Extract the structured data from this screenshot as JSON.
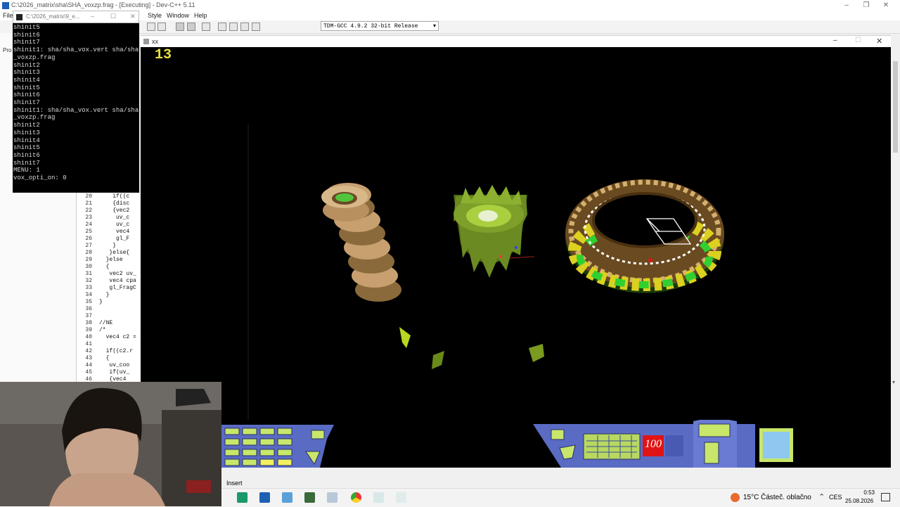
{
  "ide": {
    "title": "C:\\2026_matrix\\sha\\SHA_voxzp.frag - [Executing] - Dev-C++ 5.11",
    "menu": [
      "File",
      "Style",
      "Window",
      "Help"
    ],
    "left_tab": "Pro",
    "compiler": "TDM-GCC 4.9.2 32-bit Release",
    "status_text": "Insert"
  },
  "code": {
    "lines": [
      {
        "n": "20",
        "t": "    if((c"
      },
      {
        "n": "21",
        "t": "    {disc"
      },
      {
        "n": "22",
        "t": "    {vec2"
      },
      {
        "n": "23",
        "t": "     uv_c"
      },
      {
        "n": "24",
        "t": "     uv_c"
      },
      {
        "n": "25",
        "t": "     vec4"
      },
      {
        "n": "26",
        "t": "     gl_F"
      },
      {
        "n": "27",
        "t": "    }"
      },
      {
        "n": "28",
        "t": "   }else{"
      },
      {
        "n": "29",
        "t": "  }else"
      },
      {
        "n": "30",
        "t": "  {"
      },
      {
        "n": "31",
        "t": "   vec2 uv_"
      },
      {
        "n": "32",
        "t": "   vec4 cpa"
      },
      {
        "n": "33",
        "t": "   gl_FragC"
      },
      {
        "n": "34",
        "t": "  }"
      },
      {
        "n": "35",
        "t": "}"
      },
      {
        "n": "36",
        "t": ""
      },
      {
        "n": "37",
        "t": ""
      },
      {
        "n": "38",
        "t": "//NE"
      },
      {
        "n": "39",
        "t": "/*"
      },
      {
        "n": "40",
        "t": "  vec4 c2 ="
      },
      {
        "n": "41",
        "t": ""
      },
      {
        "n": "42",
        "t": "  if((c2.r"
      },
      {
        "n": "43",
        "t": "  {"
      },
      {
        "n": "44",
        "t": "   uv_coo"
      },
      {
        "n": "45",
        "t": "   if(uv_"
      },
      {
        "n": "46",
        "t": "   {vec4"
      }
    ]
  },
  "console": {
    "title": "C:\\2026_matrix\\9_e...",
    "lines": [
      "shinit5",
      "shinit6",
      "shinit7",
      "shinit1: sha/sha_vox.vert sha/sha",
      "_voxzp.frag",
      "shinit2",
      "shinit3",
      "shinit4",
      "shinit5",
      "shinit6",
      "shinit7",
      "shinit1: sha/sha_vox.vert sha/sha",
      "_voxzp.frag",
      "shinit2",
      "shinit3",
      "shinit4",
      "shinit5",
      "shinit6",
      "shinit7",
      "MENU: 1",
      "vox_opti_on: 0"
    ]
  },
  "game": {
    "title": "xx",
    "counter": "13",
    "hud_value": "100",
    "colors": {
      "hud": "#5a6bc4",
      "hud_accent": "#c8e66a",
      "counter": "#e8e040",
      "red": "#e01414"
    }
  },
  "taskbar": {
    "weather": "15°C  Částeč. oblačno",
    "lang": "CES",
    "time": "0:53",
    "date": "25.08.2026"
  }
}
